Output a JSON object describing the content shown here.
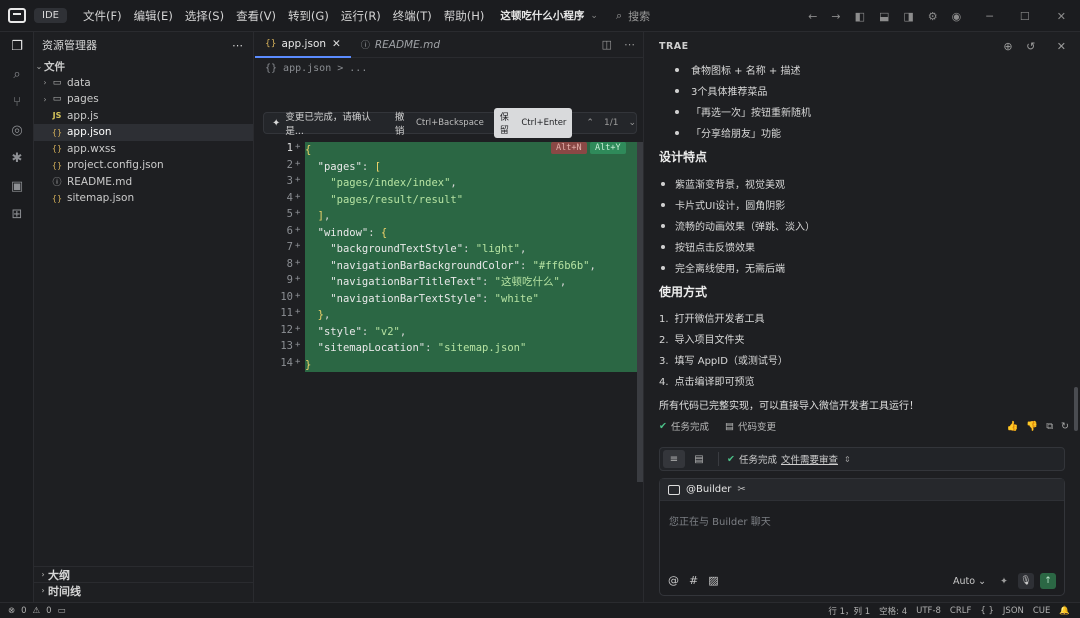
{
  "titlebar": {
    "ide_tag": "IDE",
    "menu": [
      "文件(F)",
      "编辑(E)",
      "选择(S)",
      "查看(V)",
      "转到(G)",
      "运行(R)",
      "终端(T)",
      "帮助(H)"
    ],
    "project": "这顿吃什么小程序",
    "search_placeholder": "搜索"
  },
  "explorer": {
    "title": "资源管理器",
    "root_label": "文件",
    "items": [
      {
        "label": "data",
        "type": "folder"
      },
      {
        "label": "pages",
        "type": "folder"
      },
      {
        "label": "app.js",
        "type": "js",
        "icon": "JS"
      },
      {
        "label": "app.json",
        "type": "json",
        "icon": "{}"
      },
      {
        "label": "app.wxss",
        "type": "css",
        "icon": "{}"
      },
      {
        "label": "project.config.json",
        "type": "json",
        "icon": "{}"
      },
      {
        "label": "README.md",
        "type": "md",
        "icon": "ⓘ"
      },
      {
        "label": "sitemap.json",
        "type": "json",
        "icon": "{}"
      }
    ],
    "outline_label": "大纲",
    "timeline_label": "时间线"
  },
  "editor": {
    "tabs": [
      {
        "label": "app.json",
        "icon": "{}"
      },
      {
        "label": "README.md",
        "icon": "ⓘ"
      }
    ],
    "breadcrumb": "{} app.json > ...",
    "change_bar": {
      "message": "变更已完成，请确认是...",
      "undo_label": "撤销",
      "undo_key": "Ctrl+Backspace",
      "keep_label": "保留",
      "keep_key": "Ctrl+Enter",
      "counter": "1/1"
    },
    "diff_pills": {
      "reject": "Alt+N",
      "accept": "Alt+Y"
    },
    "line_numbers": [
      "1",
      "2",
      "3",
      "4",
      "5",
      "6",
      "7",
      "8",
      "9",
      "10",
      "11",
      "12",
      "13",
      "14"
    ]
  },
  "chat": {
    "title": "TRAE",
    "bullets_top": [
      "食物图标 + 名称 + 描述",
      "3个具体推荐菜品",
      "「再选一次」按钮重新随机",
      "「分享给朋友」功能"
    ],
    "design_heading": "设计特点",
    "design_items": [
      "紫蓝渐变背景，视觉美观",
      "卡片式UI设计，圆角阴影",
      "流畅的动画效果（弹跳、淡入）",
      "按钮点击反馈效果",
      "完全离线使用，无需后端"
    ],
    "usage_heading": "使用方式",
    "usage_items": [
      "打开微信开发者工具",
      "导入项目文件夹",
      "填写 AppID（或测试号）",
      "点击编译即可预览"
    ],
    "summary": "所有代码已完整实现，可以直接导入微信开发者工具运行！",
    "task_done": "任务完成",
    "code_changes": "代码变更",
    "taskbar_done": "任务完成",
    "taskbar_link": "文件需要审查",
    "composer": {
      "mention": "@Builder",
      "placeholder": "您正在与 Builder 聊天",
      "mode": "Auto"
    }
  },
  "statusbar": {
    "errors": "0",
    "warnings": "0",
    "position": "行 1，列 1",
    "spaces": "空格: 4",
    "encoding": "UTF-8",
    "eol": "CRLF",
    "braces": "{ }",
    "language": "JSON",
    "cue": "CUE"
  },
  "colors": {
    "diff_added": "#2b6744",
    "accent": "#5b8cff",
    "success": "#4cc38a"
  }
}
